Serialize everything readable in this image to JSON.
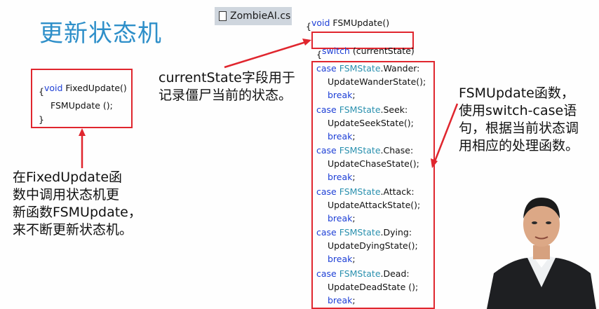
{
  "slide": {
    "title": "更新状态机",
    "file_tab": "ZombieAI.cs"
  },
  "fixed_update_code": {
    "line1_kw": "void",
    "line1_rest": " FixedUpdate()",
    "line2": "{",
    "line3": "FSMUpdate ();",
    "line4": "}"
  },
  "fsm_code": {
    "sig_kw": "void",
    "sig_rest": " FSMUpdate()",
    "open": "{",
    "switch_kw": "switch",
    "switch_rest": " (currentState)",
    "open2": "{",
    "case_kw": "case",
    "type": "FSMState",
    "break_kw": "break",
    "cases": [
      {
        "name": ".Wander:",
        "call": "UpdateWanderState();"
      },
      {
        "name": ".Seek:",
        "call": "UpdateSeekState();"
      },
      {
        "name": ".Chase:",
        "call": "UpdateChaseState();"
      },
      {
        "name": ".Attack:",
        "call": "UpdateAttackState();"
      },
      {
        "name": ".Dying:",
        "call": "UpdateDyingState();"
      },
      {
        "name": ".Dead:",
        "call": "UpdateDeadState ();"
      }
    ]
  },
  "notes": {
    "current_state": [
      "currentState字段用于",
      "记录僵尸当前的状态。"
    ],
    "fsm_update": [
      "FSMUpdate函数，",
      "使用switch-case语",
      "句，根据当前状态调",
      "用相应的处理函数。"
    ],
    "fixed_update": [
      "在FixedUpdate函",
      "数中调用状态机更",
      "新函数FSMUpdate，",
      "来不断更新状态机。"
    ]
  },
  "colors": {
    "title": "#2e8fc9",
    "keyword": "#1d3fd6",
    "type": "#2b91af",
    "highlight_box": "#e0262e"
  }
}
